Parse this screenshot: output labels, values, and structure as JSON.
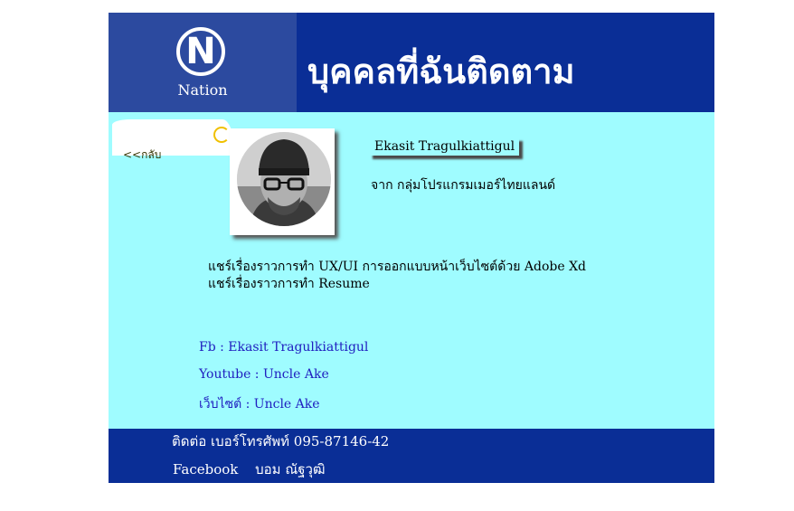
{
  "header": {
    "logo_letter": "N",
    "logo_text": "Nation",
    "title": "บุคคลที่ฉันติดตาม"
  },
  "nav": {
    "back_label": "<<กลับ"
  },
  "profile": {
    "name": "Ekasit Tragulkiattigul",
    "from": "จาก กลุ่มโปรแกรมเมอร์ไทยแลนด์",
    "shares": [
      "แชร์เรื่องราวการทำ UX/UI  การออกแบบหน้าเว็บไซต์ด้วย Adobe Xd",
      "แชร์เรื่องราวการทำ Resume"
    ],
    "links": [
      "Fb : Ekasit Tragulkiattigul",
      "Youtube : Uncle Ake",
      "เว็บไซต์ : Uncle Ake"
    ]
  },
  "footer": {
    "contact": "ติดต่อ เบอร์โทรศัพท์ 095-87146-42",
    "facebook_label": "Facebook",
    "facebook_name": "บอม ณัฐวุฒิ"
  },
  "colors": {
    "header_bg": "#0a2e96",
    "content_bg": "#9ffcff",
    "link": "#2020c0"
  },
  "icons": [
    "loading-spinner-icon",
    "nation-logo-icon"
  ]
}
